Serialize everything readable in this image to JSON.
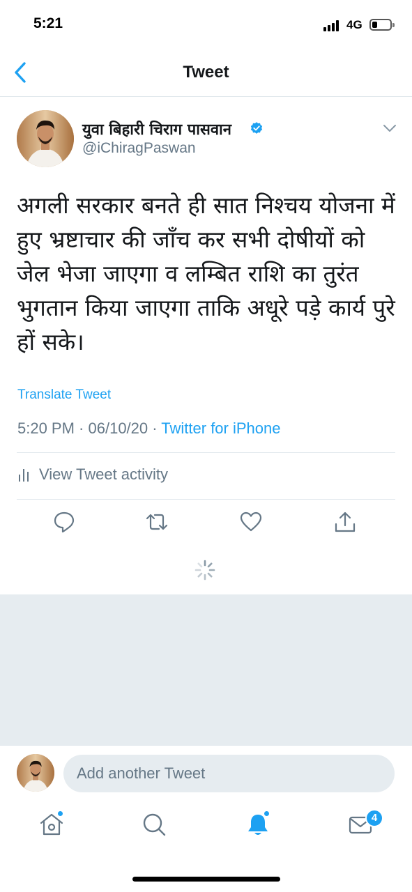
{
  "status_bar": {
    "time": "5:21",
    "network": "4G",
    "signal_bars": 4,
    "battery_level": 0.3
  },
  "header": {
    "title": "Tweet",
    "back_icon": "chevron-left-icon"
  },
  "tweet": {
    "author_name": "युवा बिहारी चिराग पासवान",
    "author_handle": "@iChiragPaswan",
    "verified": true,
    "text": "अगली सरकार बनते ही सात निश्चय योजना में हुए भ्रष्टाचार की जाँच कर सभी दोषीयों को जेल भेजा जाएगा व लम्बित राशि का तुरंत भुगतान किया जाएगा ताकि अधूरे पड़े कार्य पुरे हों सके।",
    "translate_label": "Translate Tweet",
    "time": "5:20 PM",
    "date": "06/10/20",
    "separator": " · ",
    "source": "Twitter for iPhone",
    "activity_label": "View Tweet activity"
  },
  "actions": [
    "reply-icon",
    "retweet-icon",
    "like-icon",
    "share-icon"
  ],
  "compose": {
    "placeholder": "Add another Tweet"
  },
  "tabbar": {
    "items": [
      "home-icon",
      "search-icon",
      "notifications-icon",
      "messages-icon"
    ],
    "messages_badge": "4"
  },
  "colors": {
    "accent": "#1da1f2",
    "text_primary": "#14171a",
    "text_secondary": "#657786",
    "divider": "#e1e8ed",
    "background_gray": "#e6ecf0"
  }
}
